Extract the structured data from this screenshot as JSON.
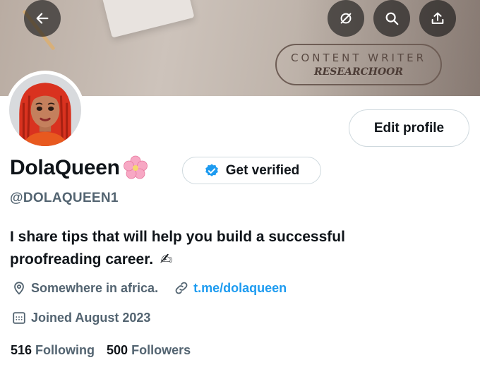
{
  "banner": {
    "tag_line1": "CONTENT WRITER",
    "tag_line2": "RESEARCHOOR"
  },
  "header_buttons": {
    "back_icon": "arrow-left-icon",
    "hide_icon": "eye-slash-icon",
    "search_icon": "search-icon",
    "share_icon": "share-icon"
  },
  "profile": {
    "display_name": "DolaQueen",
    "name_emoji": "cherry-blossom",
    "handle": "@DOLAQUEEN1",
    "bio": "I share tips that will help you build a successful proofreading career.",
    "bio_emoji": "✍",
    "location": "Somewhere in africa.",
    "link": "t.me/dolaqueen",
    "joined": "Joined August 2023",
    "following_count": "516",
    "following_label": "Following",
    "followers_count": "500",
    "followers_label": "Followers"
  },
  "actions": {
    "edit_profile": "Edit profile",
    "get_verified": "Get verified"
  },
  "colors": {
    "accent": "#1d9bf0",
    "text_primary": "#0f1419",
    "text_secondary": "#536471",
    "border": "#cfd9de"
  }
}
